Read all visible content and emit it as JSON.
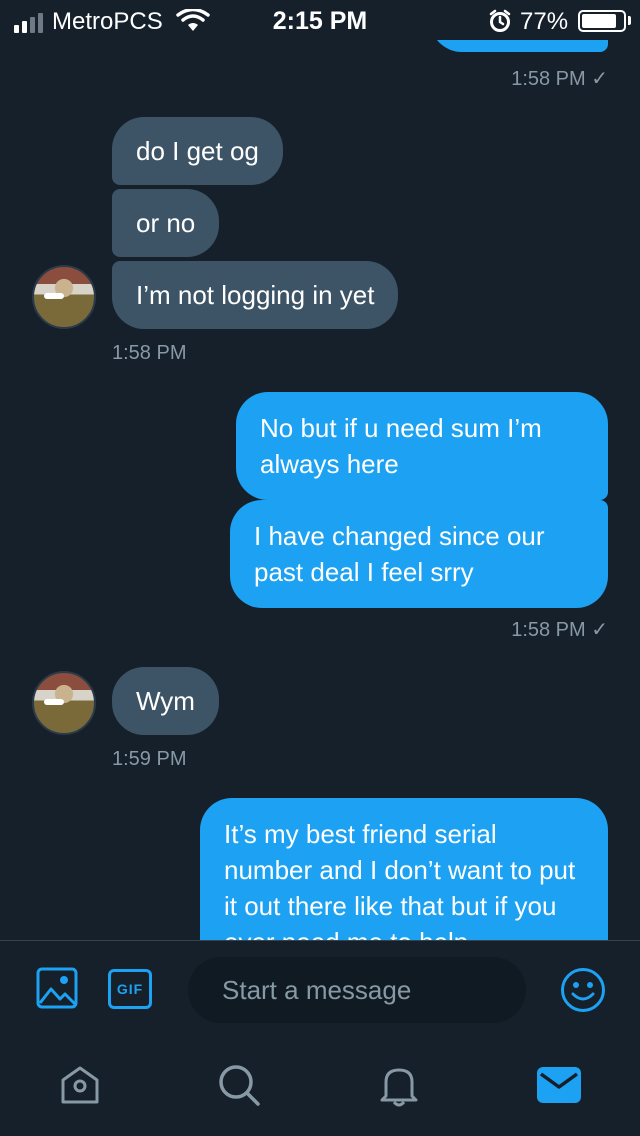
{
  "status_bar": {
    "carrier": "MetroPCS",
    "time": "2:15 PM",
    "battery_percent": "77%",
    "battery_level": 0.77,
    "signal_bars": 2,
    "icons": [
      "signal-icon",
      "wifi-icon",
      "alarm-icon",
      "battery-icon"
    ]
  },
  "conversation": {
    "accent_color": "#1da1f2",
    "incoming_color": "#3d5466",
    "background_color": "#15202b",
    "top_timestamp": "1:58 PM ✓",
    "group1": {
      "messages": [
        "do I get og",
        "or no",
        "I’m not logging in yet"
      ],
      "timestamp": "1:58 PM"
    },
    "group2": {
      "messages": [
        "No but if u need sum I’m always here",
        "I have changed since our past deal I feel srry"
      ],
      "timestamp": "1:58 PM ✓"
    },
    "group3": {
      "messages": [
        "Wym"
      ],
      "timestamp": "1:59 PM"
    },
    "group4": {
      "messages": [
        "It’s my best friend serial number and I don’t want to put it out there like that but if you ever need me to help"
      ]
    }
  },
  "composer": {
    "placeholder": "Start a message",
    "gif_label": "GIF",
    "icons": [
      "image-icon",
      "gif-icon",
      "emoji-icon"
    ]
  },
  "tab_bar": {
    "items": [
      "home-icon",
      "search-icon",
      "notifications-icon",
      "messages-icon"
    ],
    "active": "messages-icon"
  }
}
